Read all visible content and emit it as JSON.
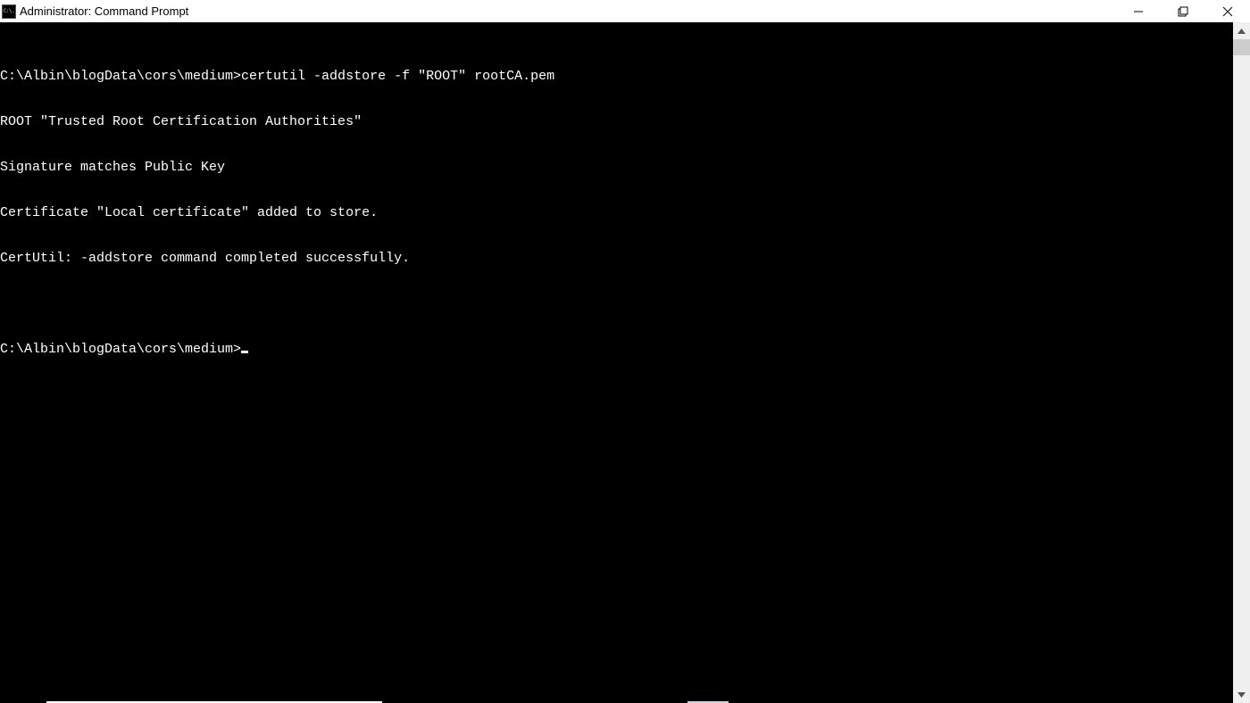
{
  "window": {
    "title": "Administrator: Command Prompt",
    "app_icon_text": "C:\\."
  },
  "terminal": {
    "lines": [
      "C:\\Albin\\blogData\\cors\\medium>certutil -addstore -f \"ROOT\" rootCA.pem",
      "ROOT \"Trusted Root Certification Authorities\"",
      "Signature matches Public Key",
      "Certificate \"Local certificate\" added to store.",
      "CertUtil: -addstore command completed successfully.",
      ""
    ],
    "prompt": "C:\\Albin\\blogData\\cors\\medium>"
  }
}
